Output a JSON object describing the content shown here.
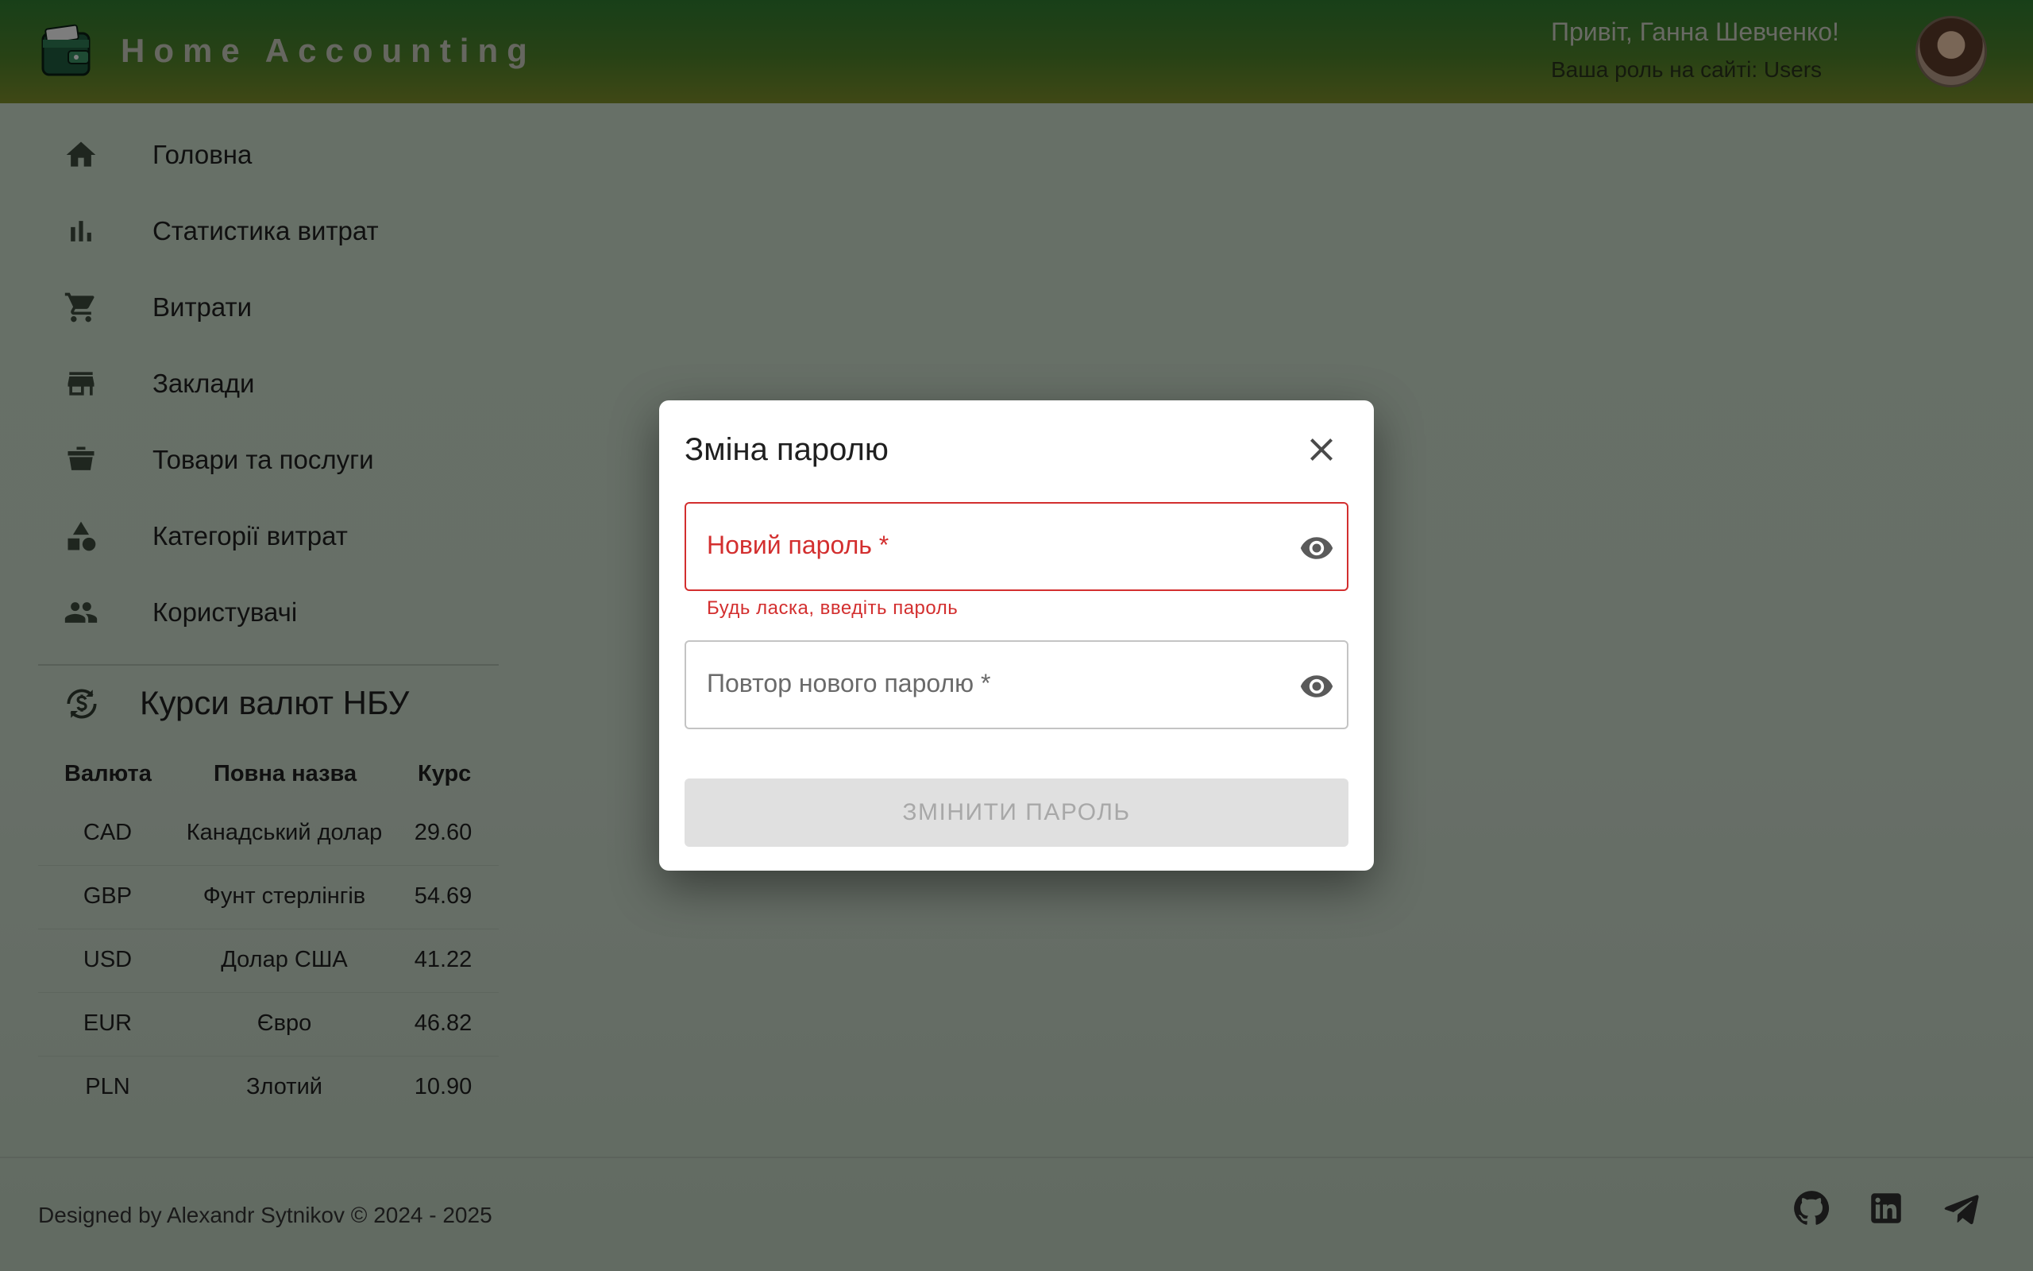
{
  "header": {
    "app_title": "Home Accounting",
    "greeting": "Привіт, Ганна Шевченко!",
    "role_text": "Ваша роль на сайті: Users"
  },
  "sidebar": {
    "items": [
      {
        "label": "Головна",
        "icon": "home-icon"
      },
      {
        "label": "Статистика витрат",
        "icon": "bar-chart-icon"
      },
      {
        "label": "Витрати",
        "icon": "shopping-cart-icon"
      },
      {
        "label": "Заклади",
        "icon": "store-icon"
      },
      {
        "label": "Товари та послуги",
        "icon": "basket-icon"
      },
      {
        "label": "Категорії витрат",
        "icon": "category-icon"
      },
      {
        "label": "Користувачі",
        "icon": "people-icon"
      }
    ]
  },
  "rates": {
    "title": "Курси валют НБУ",
    "headers": {
      "currency": "Валюта",
      "full_name": "Повна назва",
      "rate": "Курс"
    },
    "rows": [
      {
        "code": "CAD",
        "name": "Канадський долар",
        "rate": "29.60"
      },
      {
        "code": "GBP",
        "name": "Фунт стерлінгів",
        "rate": "54.69"
      },
      {
        "code": "USD",
        "name": "Долар США",
        "rate": "41.22"
      },
      {
        "code": "EUR",
        "name": "Євро",
        "rate": "46.82"
      },
      {
        "code": "PLN",
        "name": "Злотий",
        "rate": "10.90"
      }
    ]
  },
  "footer": {
    "text": "Designed by Alexandr Sytnikov © 2024 - 2025",
    "social": [
      "github-icon",
      "linkedin-icon",
      "telegram-icon"
    ]
  },
  "dialog": {
    "title": "Зміна паролю",
    "new_password_label": "Новий пароль",
    "new_password_value": "",
    "new_password_error": "Будь ласка, введіть пароль",
    "repeat_password_label": "Повтор нового паролю",
    "repeat_password_value": "",
    "required_mark": "*",
    "submit_label": "ЗМІНИТИ ПАРОЛЬ"
  },
  "colors": {
    "header_top": "#2f7a2f",
    "header_bottom": "#7a8a2a",
    "error": "#d32f2f",
    "disabled_button": "#e0e0e0"
  }
}
